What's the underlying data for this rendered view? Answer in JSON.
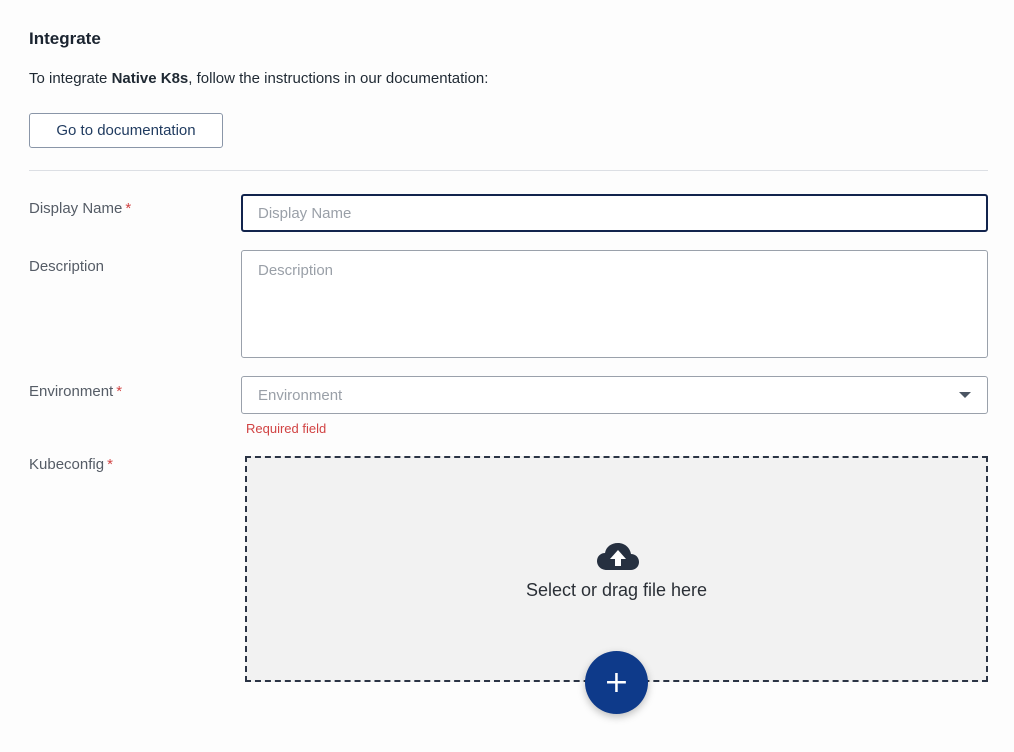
{
  "integrate": {
    "title": "Integrate",
    "intro_prefix": "To integrate ",
    "intro_bold": "Native K8s",
    "intro_suffix": ", follow the instructions in our documentation:",
    "doc_button": "Go to documentation"
  },
  "form": {
    "display_name": {
      "label": "Display Name",
      "required": "*",
      "placeholder": "Display Name",
      "value": ""
    },
    "description": {
      "label": "Description",
      "placeholder": "Description",
      "value": ""
    },
    "environment": {
      "label": "Environment",
      "required": "*",
      "placeholder": "Environment",
      "error": "Required field"
    },
    "kubeconfig": {
      "label": "Kubeconfig",
      "required": "*",
      "drop_text": "Select or drag file here",
      "upload_icon": "cloud-upload-icon",
      "add_label": "+"
    }
  },
  "colors": {
    "accent": "#0e3a8a",
    "error": "#d14343",
    "focus_border": "#12244d"
  }
}
